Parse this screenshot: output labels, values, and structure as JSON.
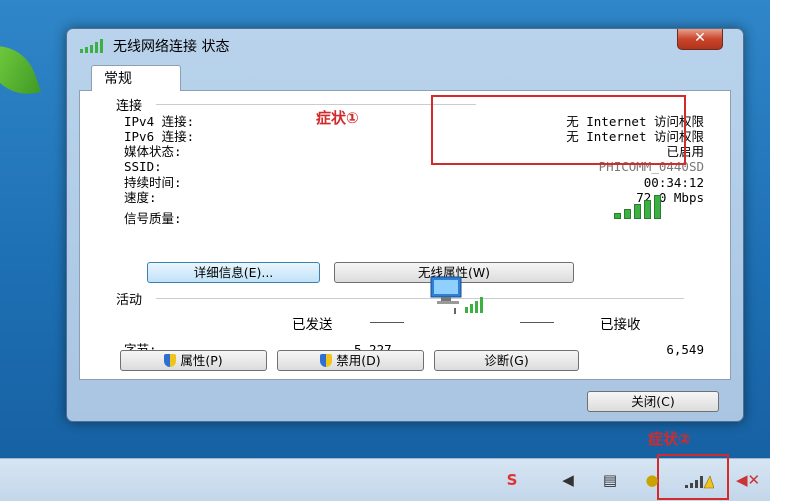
{
  "window": {
    "title": "无线网络连接 状态",
    "close_glyph": "✕",
    "tab": "常规"
  },
  "connection": {
    "section_label": "连接",
    "rows": [
      {
        "label": "IPv4 连接:",
        "value": "无 Internet 访问权限"
      },
      {
        "label": "IPv6 连接:",
        "value": "无 Internet 访问权限"
      },
      {
        "label": "媒体状态:",
        "value": "已启用"
      },
      {
        "label": "SSID:",
        "value": "PHICOMM_0440SD"
      },
      {
        "label": "持续时间:",
        "value": "00:34:12"
      },
      {
        "label": "速度:",
        "value": "72.0 Mbps"
      }
    ],
    "signal_label": "信号质量:",
    "signal_level": 5,
    "details_button": "详细信息(E)...",
    "wireless_props_button": "无线属性(W)"
  },
  "activity": {
    "section_label": "活动",
    "sent_label": "已发送",
    "received_label": "已接收",
    "bytes_label": "字节:",
    "bytes_sent": "5,227",
    "bytes_received": "6,549",
    "properties_button": "属性(P)",
    "disable_button": "禁用(D)",
    "diagnose_button": "诊断(G)"
  },
  "footer": {
    "close_button": "关闭(C)"
  },
  "annotations": {
    "symptom1": "症状①",
    "symptom2": "症状②",
    "color": "#d32b2b"
  },
  "taskbar": {
    "icons": [
      "sogou-ime-icon",
      "volume-icon",
      "clipboard-icon",
      "security-icon",
      "network-signal-icon",
      "speaker-muted-icon"
    ]
  }
}
